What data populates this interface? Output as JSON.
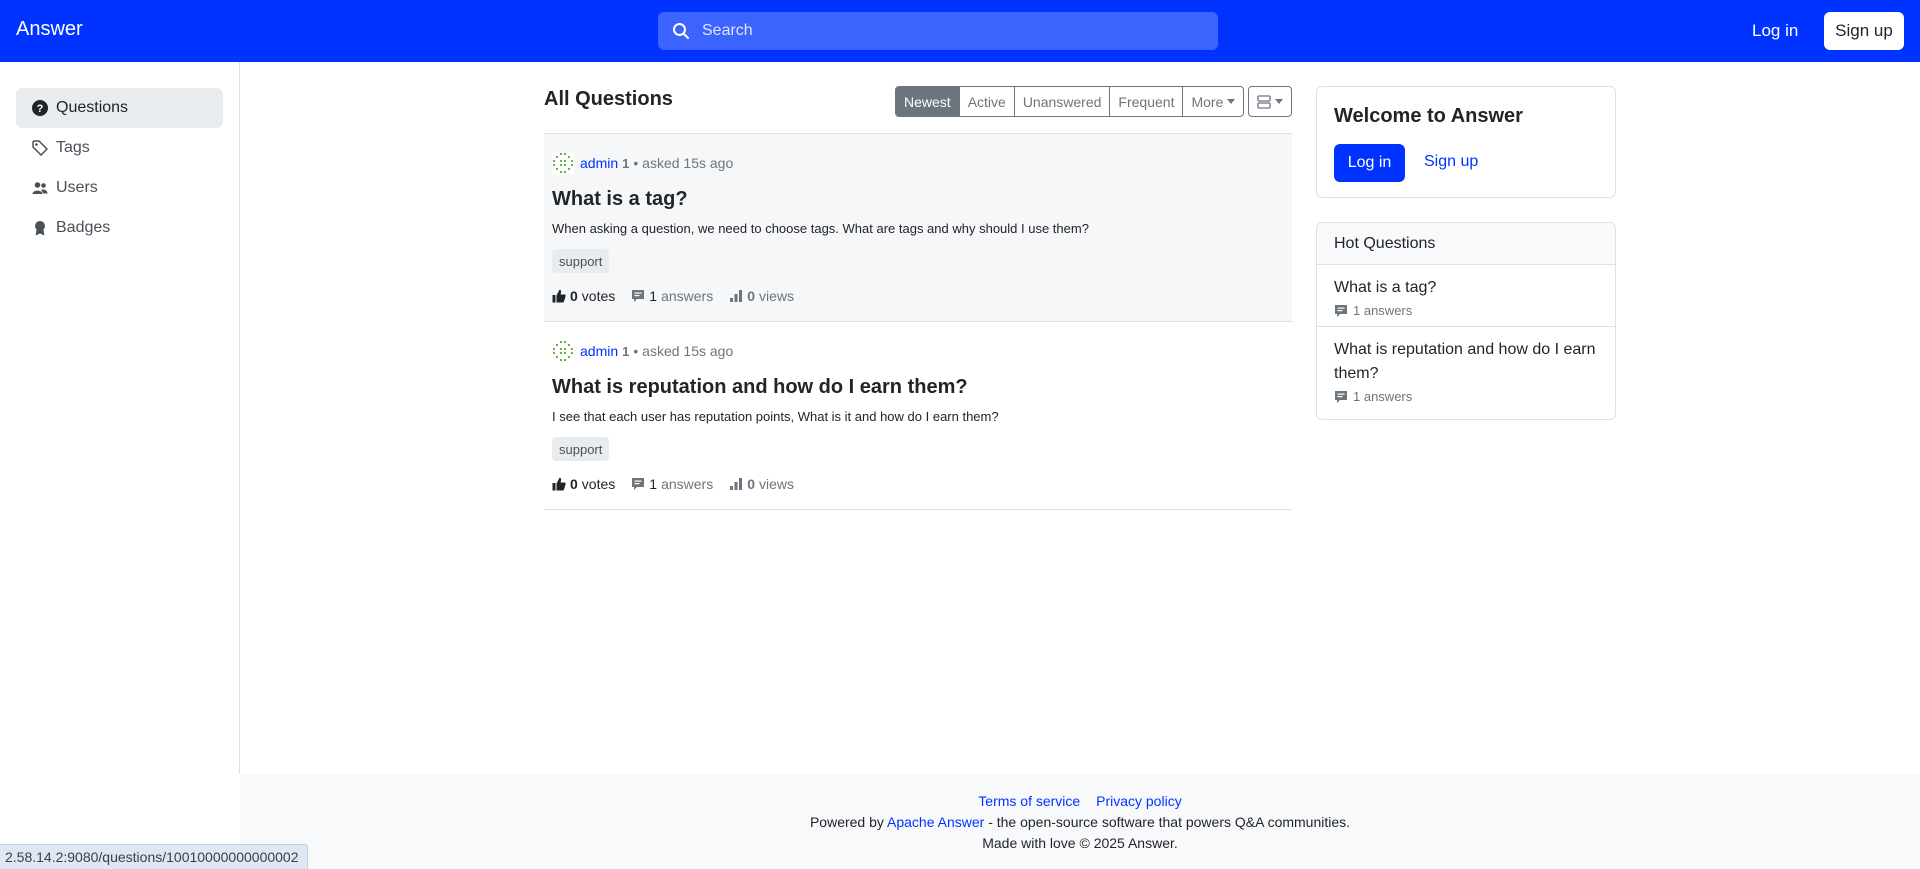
{
  "header": {
    "brand": "Answer",
    "search_placeholder": "Search",
    "login_label": "Log in",
    "signup_label": "Sign up",
    "color": "#0033ff"
  },
  "sidebar": {
    "items": [
      {
        "label": "Questions",
        "icon": "question-circle-icon",
        "active": true
      },
      {
        "label": "Tags",
        "icon": "tag-icon",
        "active": false
      },
      {
        "label": "Users",
        "icon": "users-icon",
        "active": false
      },
      {
        "label": "Badges",
        "icon": "award-icon",
        "active": false
      }
    ]
  },
  "main": {
    "title": "All Questions",
    "tabs": [
      {
        "label": "Newest",
        "active": true
      },
      {
        "label": "Active",
        "active": false
      },
      {
        "label": "Unanswered",
        "active": false
      },
      {
        "label": "Frequent",
        "active": false
      },
      {
        "label": "More",
        "active": false
      }
    ],
    "questions": [
      {
        "author": "admin",
        "reputation": "1",
        "asked": "• asked 15s ago",
        "title": "What is a tag?",
        "excerpt": "When asking a question, we need to choose tags. What are tags and why should I use them?",
        "tag": "support",
        "votes": "0",
        "votes_label": "votes",
        "answers": "1",
        "answers_label": "answers",
        "views": "0",
        "views_label": "views"
      },
      {
        "author": "admin",
        "reputation": "1",
        "asked": "• asked 15s ago",
        "title": "What is reputation and how do I earn them?",
        "excerpt": "I see that each user has reputation points, What is it and how do I earn them?",
        "tag": "support",
        "votes": "0",
        "votes_label": "votes",
        "answers": "1",
        "answers_label": "answers",
        "views": "0",
        "views_label": "views"
      }
    ]
  },
  "welcome": {
    "title": "Welcome to Answer",
    "login_label": "Log in",
    "signup_label": "Sign up"
  },
  "hot": {
    "title": "Hot Questions",
    "items": [
      {
        "title": "What is a tag?",
        "answers": "1 answers"
      },
      {
        "title": "What is reputation and how do I earn them?",
        "answers": "1 answers"
      }
    ]
  },
  "footer": {
    "terms": "Terms of service",
    "privacy": "Privacy policy",
    "powered_prefix": "Powered by ",
    "powered_link": "Apache Answer",
    "powered_suffix": " - the open-source software that powers Q&A communities.",
    "made": "Made with love © 2025 Answer."
  },
  "statusbar": {
    "url": "2.58.14.2:9080/questions/10010000000000002"
  }
}
